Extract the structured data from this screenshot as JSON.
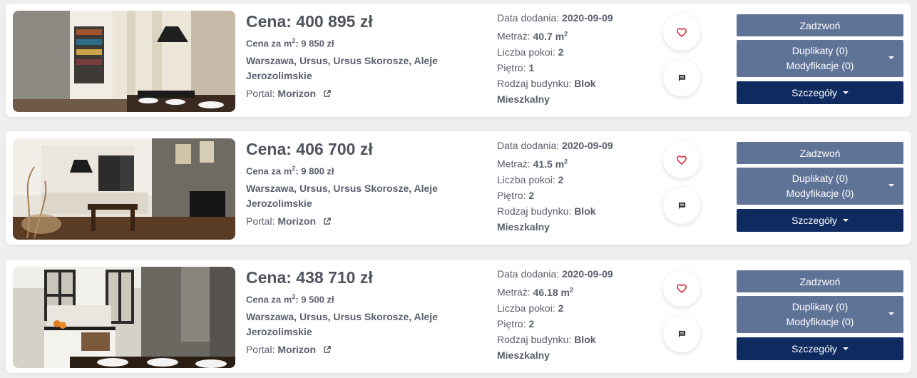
{
  "listings": [
    {
      "price": "Cena: 400 895 zł",
      "ppm_label": "Cena za m",
      "ppm_sup": "2",
      "ppm_value": ": 9 850 zł",
      "address": "Warszawa, Ursus, Ursus Skorosze, Aleje Jerozolimskie",
      "portal_label": "Portal: ",
      "portal_name": "Morizon",
      "date_label": "Data dodania: ",
      "date_value": "2020-09-09",
      "area_label": "Metraż: ",
      "area_value": "40.7 m",
      "area_sup": "2",
      "rooms_label": "Liczba pokoi: ",
      "rooms_value": "2",
      "floor_label": "Piętro: ",
      "floor_value": "1",
      "building_label": "Rodzaj budynku: ",
      "building_value": "Blok Mieszkalny",
      "call_label": "Zadzwoń",
      "duplicates_label": "Duplikaty (0)",
      "modifications_label": "Modyfikacje (0)",
      "details_label": "Szczegóły"
    },
    {
      "price": "Cena: 406 700 zł",
      "ppm_label": "Cena za m",
      "ppm_sup": "2",
      "ppm_value": ": 9 800 zł",
      "address": "Warszawa, Ursus, Ursus Skorosze, Aleje Jerozolimskie",
      "portal_label": "Portal: ",
      "portal_name": "Morizon",
      "date_label": "Data dodania: ",
      "date_value": "2020-09-09",
      "area_label": "Metraż: ",
      "area_value": "41.5 m",
      "area_sup": "2",
      "rooms_label": "Liczba pokoi: ",
      "rooms_value": "2",
      "floor_label": "Piętro: ",
      "floor_value": "2",
      "building_label": "Rodzaj budynku: ",
      "building_value": "Blok Mieszkalny",
      "call_label": "Zadzwoń",
      "duplicates_label": "Duplikaty (0)",
      "modifications_label": "Modyfikacje (0)",
      "details_label": "Szczegóły"
    },
    {
      "price": "Cena: 438 710 zł",
      "ppm_label": "Cena za m",
      "ppm_sup": "2",
      "ppm_value": ": 9 500 zł",
      "address": "Warszawa, Ursus, Ursus Skorosze, Aleje Jerozolimskie",
      "portal_label": "Portal: ",
      "portal_name": "Morizon",
      "date_label": "Data dodania: ",
      "date_value": "2020-09-09",
      "area_label": "Metraż: ",
      "area_value": "46.18 m",
      "area_sup": "2",
      "rooms_label": "Liczba pokoi: ",
      "rooms_value": "2",
      "floor_label": "Piętro: ",
      "floor_value": "2",
      "building_label": "Rodzaj budynku: ",
      "building_value": "Blok Mieszkalny",
      "call_label": "Zadzwoń",
      "duplicates_label": "Duplikaty (0)",
      "modifications_label": "Modyfikacje (0)",
      "details_label": "Szczegóły"
    }
  ],
  "icons": {
    "favorite": "heart-icon",
    "comment": "comment-icon",
    "external": "external-link-icon",
    "dropdown": "caret-down-icon"
  },
  "colors": {
    "button_primary": "#5f7397",
    "button_dark": "#0f2a5e",
    "heart": "#d9263b",
    "text": "#5b5f6e"
  }
}
